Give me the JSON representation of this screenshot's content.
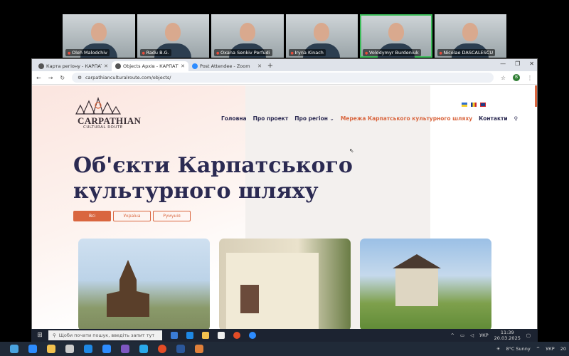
{
  "participants": [
    {
      "name": "Oleh Malodchiv"
    },
    {
      "name": "Radu B.G."
    },
    {
      "name": "Oxana Senkiv Perfudi"
    },
    {
      "name": "Iryna Kinach"
    },
    {
      "name": "Volodymyr Burdeniuk"
    },
    {
      "name": "Nicolae DASCALESCU"
    }
  ],
  "browser": {
    "tabs": [
      {
        "title": "Карта регіону - КАРПАТСЬКИЙ"
      },
      {
        "title": "Objects Архів - КАРПАТСЬКИЙ"
      },
      {
        "title": "Post Attendee - Zoom"
      }
    ],
    "url": "carpathianculturalroute.com/objects/",
    "profile": "B"
  },
  "site": {
    "logo_line1": "CARPATHIAN",
    "logo_line2": "CULTURAL ROUTE",
    "nav": [
      "Головна",
      "Про проект",
      "Про регіон",
      "Мережа Карпатського культурного шляху",
      "Контакти"
    ],
    "heading": "Об'єкти Карпатського культурного шляху",
    "filters": [
      "Всі",
      "Україна",
      "Румунія"
    ]
  },
  "taskbar": {
    "search_placeholder": "Щоби почати пошук, введіть запит тут",
    "lang": "УКР",
    "time": "11:39",
    "date": "20.03.2025"
  },
  "dock": {
    "weather": "8°C Sunny",
    "lang": "УКР"
  }
}
